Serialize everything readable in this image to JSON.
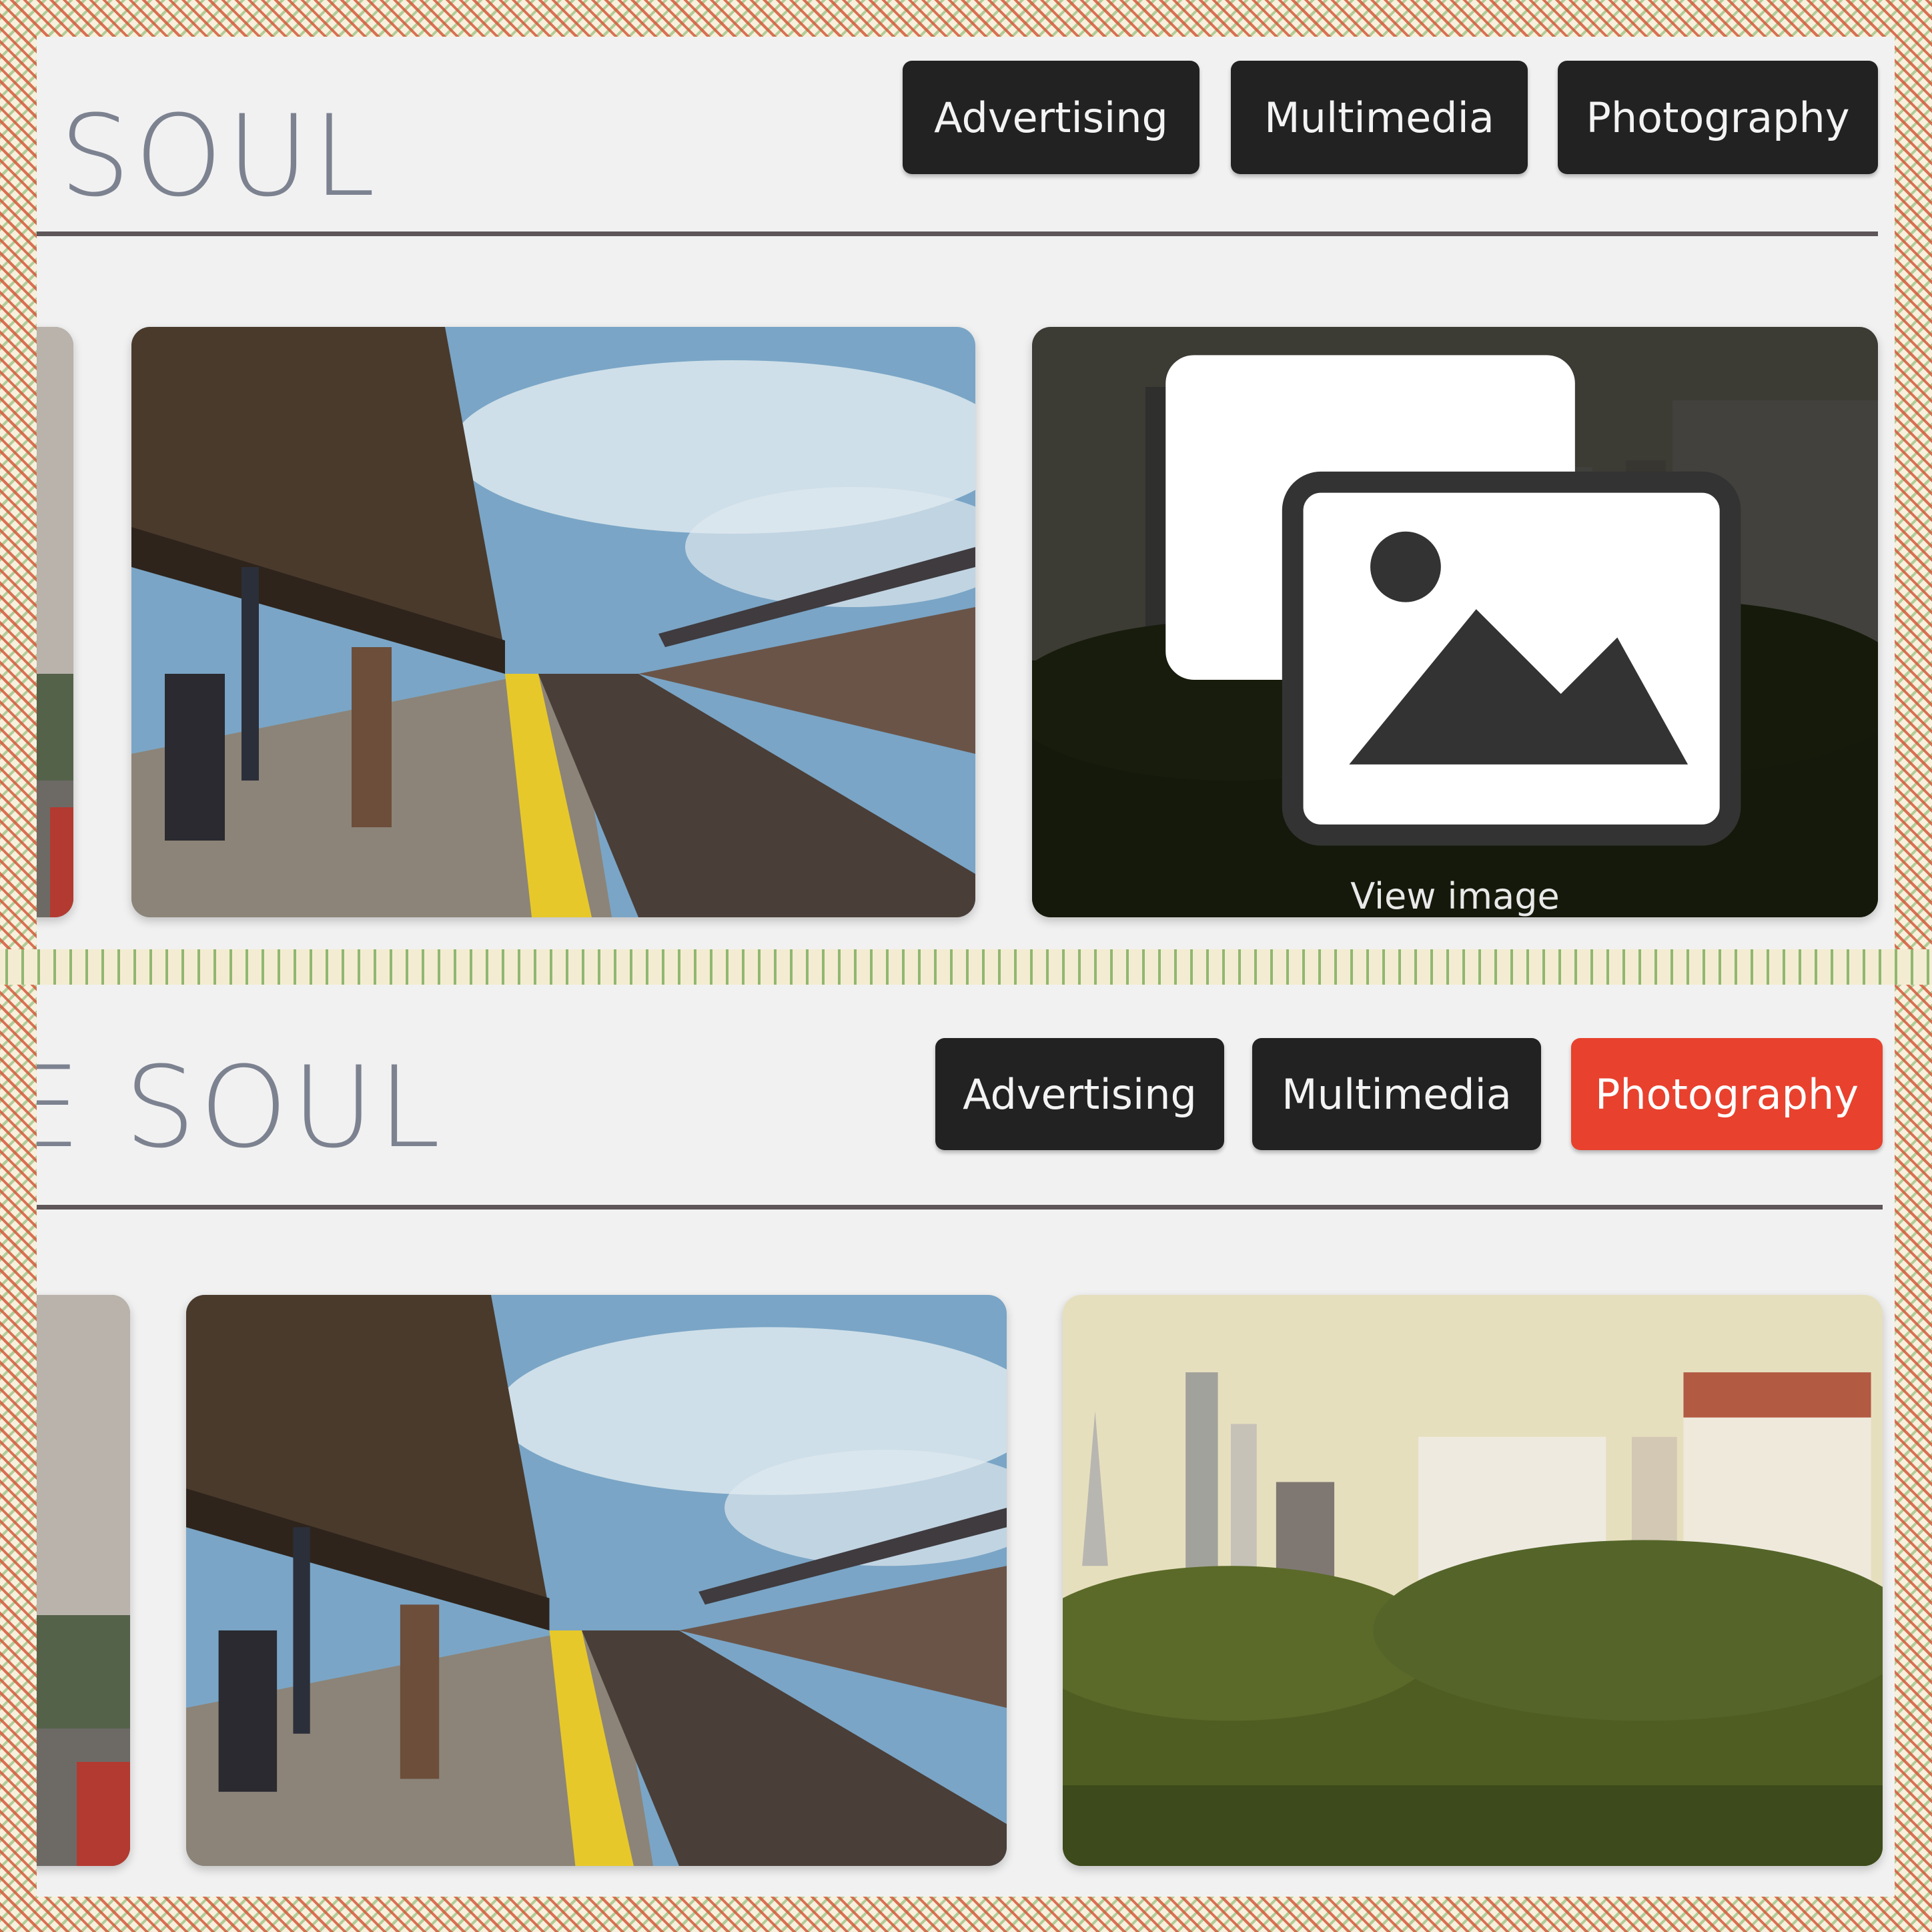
{
  "screens": [
    {
      "logo_text": "SOUL",
      "nav": [
        {
          "label": "Advertising",
          "active": false
        },
        {
          "label": "Multimedia",
          "active": false
        },
        {
          "label": "Photography",
          "active": false
        }
      ],
      "gallery": {
        "overlay_label": "View image",
        "overlay_icon": "images-icon"
      }
    },
    {
      "logo_text": "E SOUL",
      "nav": [
        {
          "label": "Advertising",
          "active": false
        },
        {
          "label": "Multimedia",
          "active": false
        },
        {
          "label": "Photography",
          "active": true
        }
      ]
    }
  ],
  "colors": {
    "active_nav": "#e8412e",
    "nav_bg": "#222222",
    "rule": "#5e5659"
  }
}
